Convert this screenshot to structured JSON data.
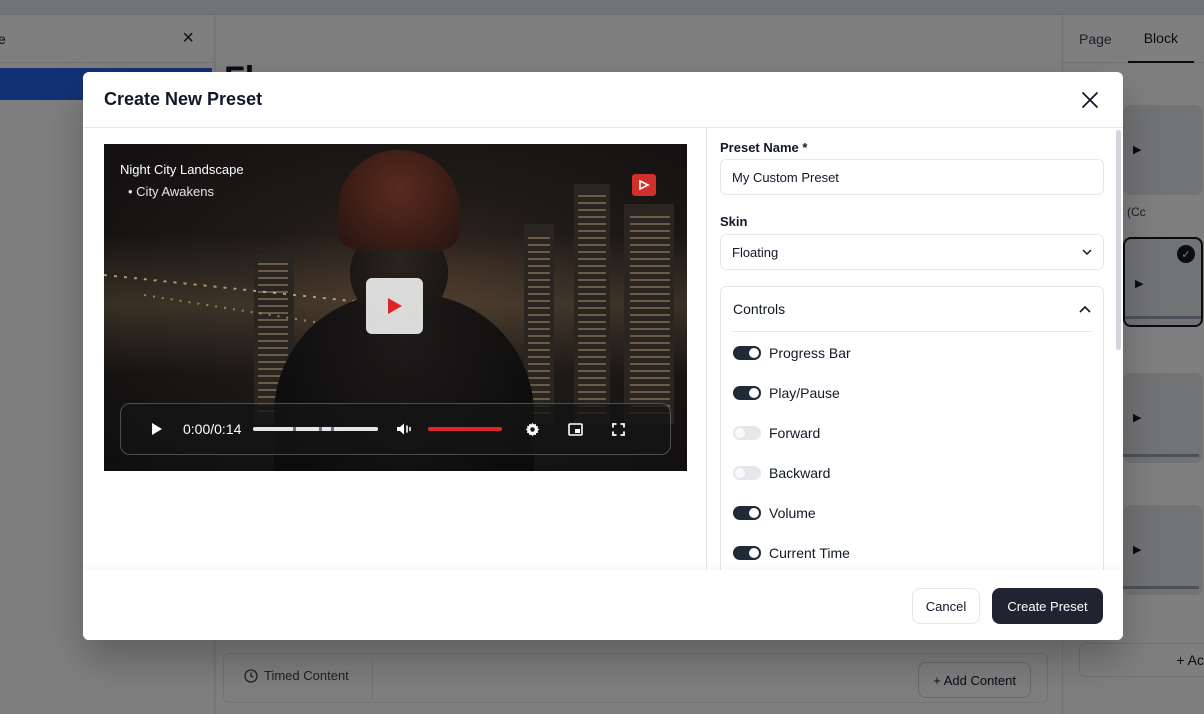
{
  "background": {
    "left_panel_title": "e",
    "page_title": "Flo...tPl...",
    "right_tabs": [
      "Page",
      "Block"
    ],
    "card_label_1": "(Cc",
    "timed_content": "Timed Content",
    "add_content": "+ Add Content",
    "add_right": "+ Ac"
  },
  "modal": {
    "title": "Create New Preset",
    "video": {
      "title": "Night City Landscape",
      "subtitle": "• City Awakens",
      "time": "0:00/0:14",
      "progress_buffered_fraction": 1.0,
      "volume_fraction": 1.0
    },
    "form": {
      "preset_name_label": "Preset Name *",
      "preset_name_value": "My Custom Preset",
      "skin_label": "Skin",
      "skin_value": "Floating",
      "controls_title": "Controls",
      "controls": [
        {
          "label": "Progress Bar",
          "on": true
        },
        {
          "label": "Play/Pause",
          "on": true
        },
        {
          "label": "Forward",
          "on": false
        },
        {
          "label": "Backward",
          "on": false
        },
        {
          "label": "Volume",
          "on": true
        },
        {
          "label": "Current Time",
          "on": true
        }
      ]
    },
    "footer": {
      "cancel_label": "Cancel",
      "create_label": "Create Preset"
    }
  },
  "colors": {
    "accent": "#dc2626",
    "primary_button": "#1f2430",
    "toggle_on": "#1f2937"
  }
}
